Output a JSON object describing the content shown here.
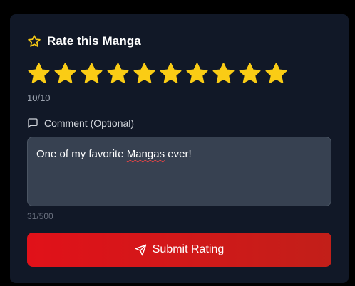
{
  "card": {
    "title": "Rate this Manga",
    "title_icon": "star-outline-icon"
  },
  "rating": {
    "max": 10,
    "value": 10,
    "display": "10/10",
    "star_color": "#facc15"
  },
  "comment": {
    "label": "Comment (Optional)",
    "label_icon": "message-square-icon",
    "value_before": "One of my favorite ",
    "value_misspelled": "Mangas",
    "value_after": " ever!",
    "char_count": "31/500"
  },
  "submit": {
    "label": "Submit Rating",
    "icon": "send-icon",
    "color": "#dc1418"
  }
}
